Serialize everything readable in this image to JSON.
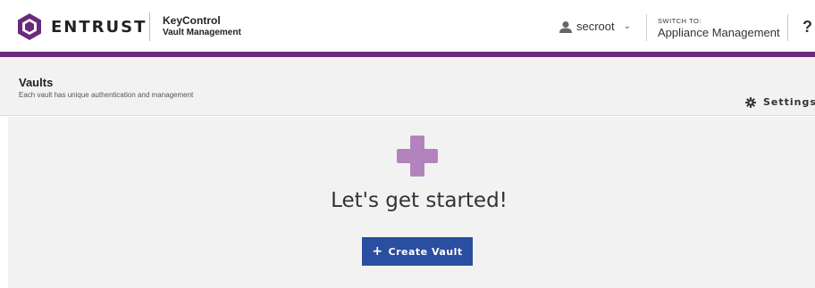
{
  "header": {
    "brand": "ENTRUST",
    "product_name": "KeyControl",
    "product_sub": "Vault Management",
    "user_name": "secroot",
    "user_caret": "⌄",
    "switch_label": "SWITCH TO:",
    "switch_target": "Appliance Management",
    "help_label": "?"
  },
  "subheader": {
    "title": "Vaults",
    "description": "Each vault has unique authentication and management",
    "settings_label": "Settings"
  },
  "main": {
    "headline": "Let's get started!",
    "create_button_label": "Create Vault",
    "create_button_icon": "+"
  },
  "colors": {
    "brand_purple": "#6a2a7a",
    "plus_purple": "#b383bd",
    "button_blue": "#2a4ea0"
  },
  "icons": [
    "entrust-logo-icon",
    "user-icon",
    "chevron-down-icon",
    "gear-icon",
    "plus-icon"
  ]
}
